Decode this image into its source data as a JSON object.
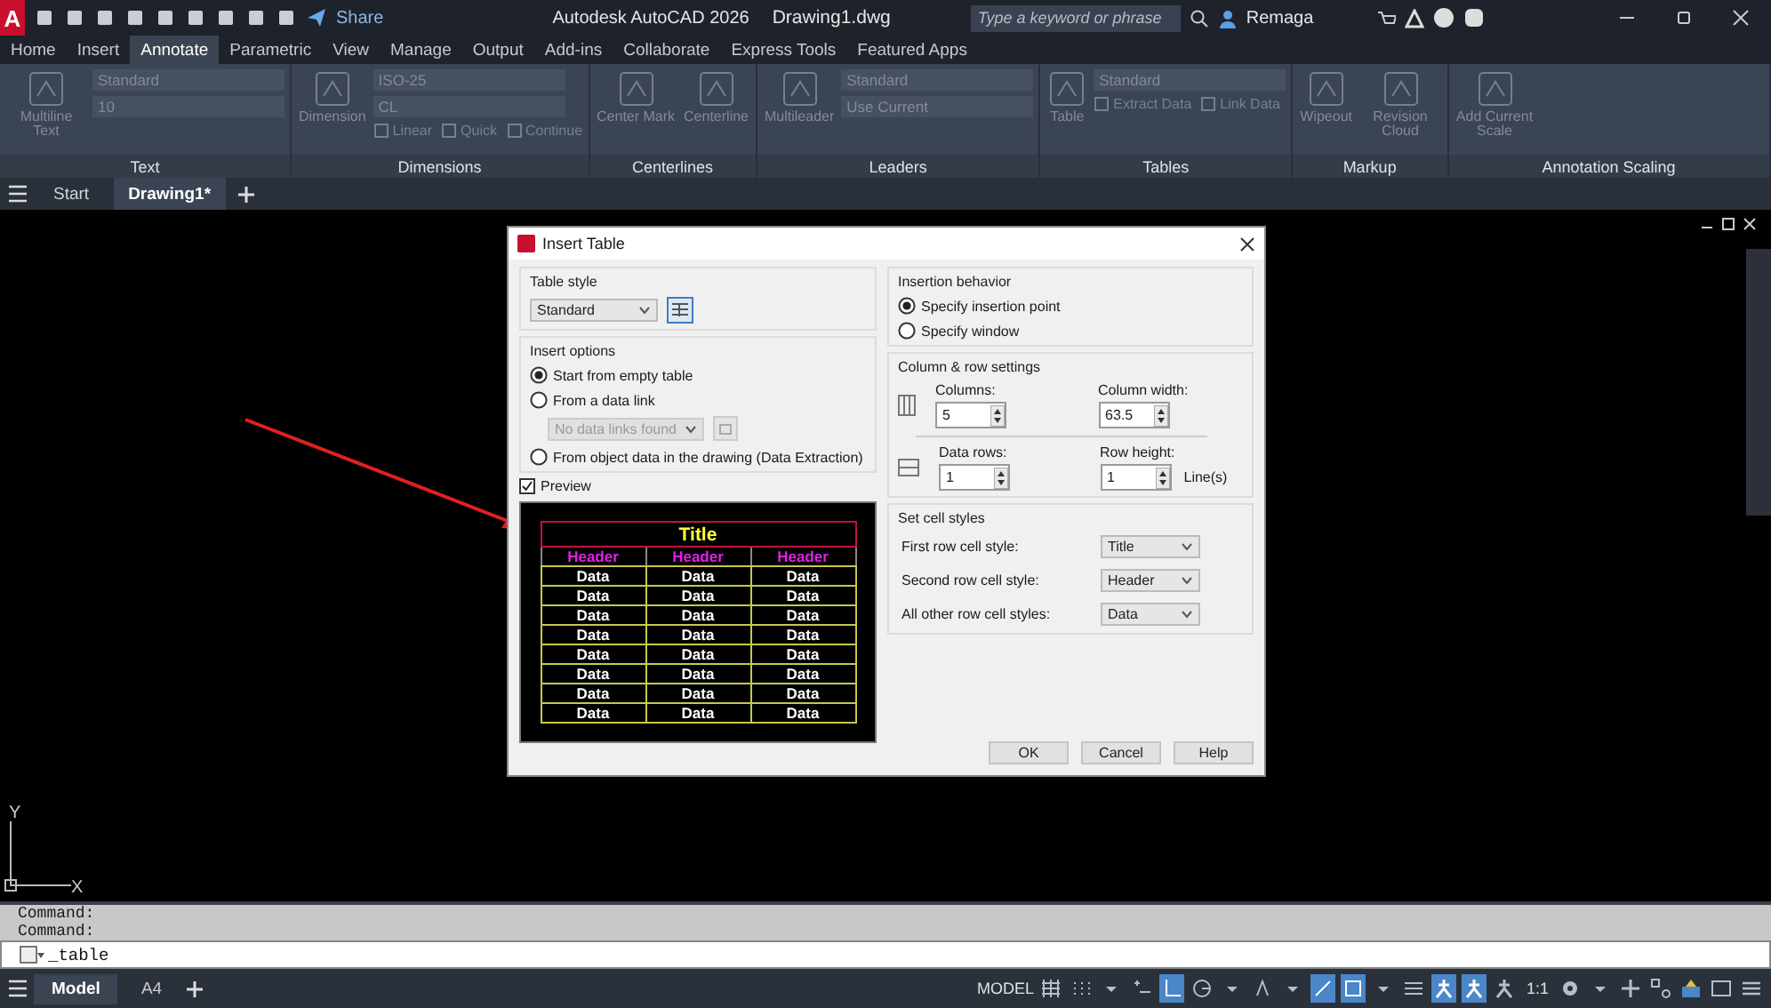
{
  "title_bar": {
    "logo": "A",
    "share": "Share",
    "app_title": "Autodesk AutoCAD 2026",
    "file_name": "Drawing1.dwg",
    "search": {
      "placeholder": "Type a keyword or phrase"
    },
    "user": "Remaga"
  },
  "ribbon_tabs": [
    {
      "label": "Home",
      "selected": false
    },
    {
      "label": "Insert",
      "selected": false
    },
    {
      "label": "Annotate",
      "selected": true
    },
    {
      "label": "Parametric",
      "selected": false
    },
    {
      "label": "View",
      "selected": false
    },
    {
      "label": "Manage",
      "selected": false
    },
    {
      "label": "Output",
      "selected": false
    },
    {
      "label": "Add-ins",
      "selected": false
    },
    {
      "label": "Collaborate",
      "selected": false
    },
    {
      "label": "Express Tools",
      "selected": false
    },
    {
      "label": "Featured Apps",
      "selected": false
    }
  ],
  "ribbon_panels": [
    {
      "title": "Text",
      "big_buttons": [
        "Multiline Text"
      ],
      "dropdowns": [
        "Standard",
        "10"
      ]
    },
    {
      "title": "Dimensions",
      "big_buttons": [
        "Dimension"
      ],
      "dropdowns": [
        "ISO-25",
        "CL"
      ],
      "small_buttons": [
        "Linear",
        "Quick",
        "Continue"
      ]
    },
    {
      "title": "Centerlines",
      "big_buttons": [
        "Center Mark",
        "Centerline"
      ]
    },
    {
      "title": "Leaders",
      "big_buttons": [
        "Multileader"
      ],
      "dropdowns": [
        "Standard",
        "Use Current"
      ]
    },
    {
      "title": "Tables",
      "big_buttons": [
        "Table"
      ],
      "dropdowns": [
        "Standard"
      ],
      "small_buttons": [
        "Extract Data",
        "Link Data"
      ]
    },
    {
      "title": "Markup",
      "big_buttons": [
        "Wipeout",
        "Revision Cloud"
      ]
    },
    {
      "title": "Annotation Scaling",
      "big_buttons": [
        "Add Current Scale"
      ]
    }
  ],
  "file_tabs": [
    {
      "label": "Start",
      "selected": false
    },
    {
      "label": "Drawing1*",
      "selected": true
    }
  ],
  "ucs": {
    "x_label": "X",
    "y_label": "Y"
  },
  "dialog": {
    "title": "Insert Table",
    "table_style": {
      "label": "Table style",
      "value": "Standard"
    },
    "insert_options": {
      "label": "Insert options",
      "options": [
        {
          "label": "Start from empty table",
          "selected": true
        },
        {
          "label": "From a data link",
          "selected": false
        },
        {
          "label": "From object data in the drawing (Data Extraction)",
          "selected": false
        }
      ],
      "data_link": {
        "value": "No data links found",
        "disabled": true
      }
    },
    "preview": {
      "label": "Preview",
      "checked": true,
      "title": "Title",
      "headers": [
        "Header",
        "Header",
        "Header"
      ],
      "rows": [
        [
          "Data",
          "Data",
          "Data"
        ],
        [
          "Data",
          "Data",
          "Data"
        ],
        [
          "Data",
          "Data",
          "Data"
        ],
        [
          "Data",
          "Data",
          "Data"
        ],
        [
          "Data",
          "Data",
          "Data"
        ],
        [
          "Data",
          "Data",
          "Data"
        ],
        [
          "Data",
          "Data",
          "Data"
        ],
        [
          "Data",
          "Data",
          "Data"
        ]
      ]
    },
    "insertion_behavior": {
      "label": "Insertion behavior",
      "options": [
        {
          "label": "Specify insertion point",
          "selected": true
        },
        {
          "label": "Specify window",
          "selected": false
        }
      ]
    },
    "column_row_settings": {
      "label": "Column & row settings",
      "columns": {
        "label": "Columns:",
        "value": "5"
      },
      "column_width": {
        "label": "Column width:",
        "value": "63.5"
      },
      "data_rows": {
        "label": "Data rows:",
        "value": "1"
      },
      "row_height": {
        "label": "Row height:",
        "value": "1",
        "unit": "Line(s)"
      }
    },
    "cell_styles": {
      "label": "Set cell styles",
      "rows": [
        {
          "label": "First row cell style:",
          "value": "Title"
        },
        {
          "label": "Second row cell style:",
          "value": "Header"
        },
        {
          "label": "All other row cell styles:",
          "value": "Data"
        }
      ]
    },
    "buttons": [
      "OK",
      "Cancel",
      "Help"
    ]
  },
  "command_history": [
    "Command:",
    "Command:"
  ],
  "command_input": "_table",
  "layout_tabs": [
    {
      "label": "Model",
      "selected": true
    },
    {
      "label": "A4",
      "selected": false
    }
  ],
  "status_bar": {
    "mode": "MODEL",
    "scale": "1:1",
    "tools": [
      {
        "kind": "grid",
        "on": false
      },
      {
        "kind": "snap",
        "on": false
      },
      {
        "kind": "caret",
        "on": false
      },
      {
        "kind": "dynamic",
        "on": false
      },
      {
        "kind": "ortho",
        "on": true
      },
      {
        "kind": "polar",
        "on": false
      },
      {
        "kind": "caret",
        "on": false
      },
      {
        "kind": "iso",
        "on": false
      },
      {
        "kind": "caret",
        "on": false
      },
      {
        "kind": "tracking",
        "on": true
      },
      {
        "kind": "osnap",
        "on": true
      },
      {
        "kind": "caret",
        "on": false
      },
      {
        "kind": "lineweight",
        "on": false
      },
      {
        "kind": "annotation",
        "on": true
      },
      {
        "kind": "annotation",
        "on": true
      },
      {
        "kind": "annotation",
        "on": false
      }
    ],
    "tail_tools": [
      {
        "kind": "gear",
        "on": false
      },
      {
        "kind": "caret",
        "on": false
      },
      {
        "kind": "plus",
        "on": false
      },
      {
        "kind": "isolate",
        "on": false
      },
      {
        "kind": "hardware",
        "on": false
      },
      {
        "kind": "fullscreen",
        "on": false
      },
      {
        "kind": "menu",
        "on": false
      }
    ]
  }
}
